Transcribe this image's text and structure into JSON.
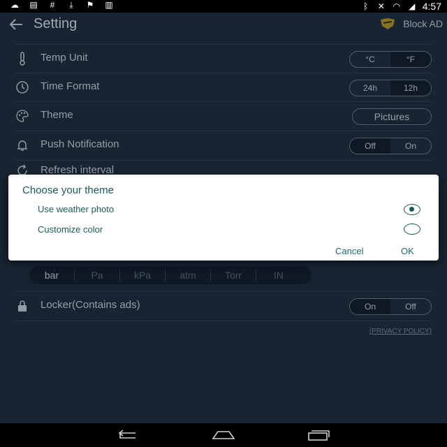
{
  "status_bar": {
    "left_icons": [
      "cloud-icon",
      "printer-icon",
      "hash-icon",
      "download-icon",
      "flag-icon",
      "barcode-icon"
    ],
    "right_icons": [
      "bluetooth-icon",
      "mute-icon",
      "wifi-icon",
      "signal-icon"
    ],
    "time": "4:57"
  },
  "appbar": {
    "title": "Setting",
    "block_ad_label": "Block AD"
  },
  "settings": {
    "temp_unit": {
      "label": "Temp Unit",
      "options": [
        "°C",
        "°F"
      ],
      "selected": "°F"
    },
    "time_format": {
      "label": "Time Format",
      "options": [
        "24h",
        "12h"
      ],
      "selected": "12h"
    },
    "theme": {
      "label": "Theme",
      "value": "Pictures"
    },
    "push_notification": {
      "label": "Push Notification",
      "options": [
        "Off",
        "On"
      ],
      "selected": "Off"
    },
    "refresh_interval": {
      "label": "Refresh interval"
    },
    "pressure_units": [
      "bar",
      "Pa",
      "kPa",
      "atm",
      "Torr",
      "IN"
    ],
    "pressure_selected": "bar",
    "locker": {
      "label": "Locker(Contains ads)",
      "options": [
        "On",
        "Off"
      ],
      "selected": "On"
    },
    "privacy_policy": "(PRIVACY POLICY)"
  },
  "dialog": {
    "title": "Choose your theme",
    "options": [
      "Use weather photo",
      "Customize color"
    ],
    "selected_index": 0,
    "cancel": "Cancel",
    "ok": "OK"
  },
  "colors": {
    "background": "#1f3042",
    "dialog_accent": "#1a5a56"
  }
}
